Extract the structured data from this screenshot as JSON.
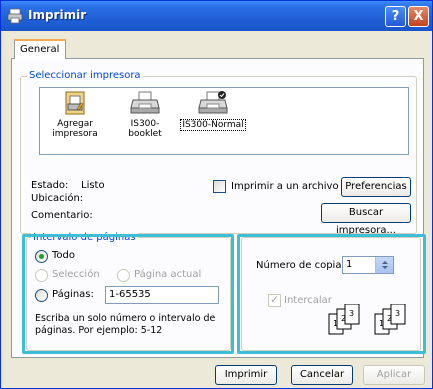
{
  "window": {
    "title": "Imprimir",
    "help_glyph": "?",
    "close_glyph": "X"
  },
  "tabs": [
    {
      "label": "General"
    }
  ],
  "select_printer": {
    "legend": "Seleccionar impresora",
    "printers": [
      {
        "label_line1": "Agregar",
        "label_line2": "impresora",
        "icon": "add-printer-icon"
      },
      {
        "label_line1": "IS300-booklet",
        "label_line2": "",
        "icon": "printer-icon"
      },
      {
        "label_line1": "IS300-Normal",
        "label_line2": "",
        "icon": "default-printer-icon",
        "selected": true
      }
    ],
    "status_label": "Estado:",
    "status_value": "Listo",
    "location_label": "Ubicación:",
    "comment_label": "Comentario:",
    "print_to_file_label": "Imprimir a un archivo",
    "preferences_button": "Preferencias",
    "find_printer_button": "Buscar impresora..."
  },
  "page_range": {
    "legend": "Intervalo de páginas",
    "all_label": "Todo",
    "selection_label": "Selección",
    "current_page_label": "Página actual",
    "pages_label": "Páginas:",
    "pages_value": "1-65535",
    "hint_line1": "Escriba un solo número o intervalo de",
    "hint_line2": "páginas. Por ejemplo: 5-12"
  },
  "copies": {
    "label": "Número de copias:",
    "value": "1",
    "collate_label": "Intercalar",
    "collate_pages": [
      "1",
      "2",
      "3",
      "1",
      "2",
      "3"
    ]
  },
  "footer": {
    "print_button": "Imprimir",
    "cancel_button": "Cancelar",
    "apply_button": "Aplicar"
  },
  "colors": {
    "titlebar": "#1f5fd6",
    "highlight": "#3dbdd6",
    "legend_text": "#0046d5"
  }
}
